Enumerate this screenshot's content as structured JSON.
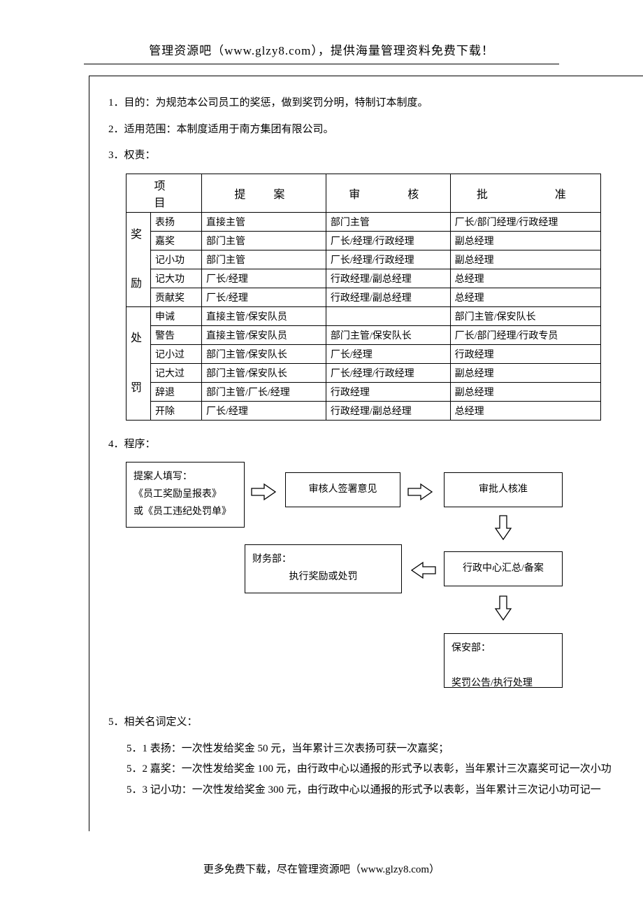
{
  "header": "管理资源吧（www.glzy8.com），提供海量管理资料免费下载！",
  "footer": "更多免费下载，尽在管理资源吧（www.glzy8.com）",
  "paras": {
    "p1": "1．目的：为规范本公司员工的奖惩，做到奖罚分明，特制订本制度。",
    "p2": "2．适用范围：本制度适用于南方集团有限公司。",
    "p3": "3．权责：",
    "p4": "4．程序：",
    "p5": "5．相关名词定义："
  },
  "table": {
    "headers": [
      "项　　目",
      "提　案",
      "审　　核",
      "批　　　准"
    ],
    "groups": [
      {
        "label": "奖励",
        "rows": [
          {
            "sub": "表扬",
            "a": "直接主管",
            "b": "部门主管",
            "c": "厂长/部门经理/行政经理"
          },
          {
            "sub": "嘉奖",
            "a": "部门主管",
            "b": "厂长/经理/行政经理",
            "c": "副总经理"
          },
          {
            "sub": "记小功",
            "a": "部门主管",
            "b": "厂长/经理/行政经理",
            "c": "副总经理"
          },
          {
            "sub": "记大功",
            "a": "厂长/经理",
            "b": "行政经理/副总经理",
            "c": "总经理"
          },
          {
            "sub": "贡献奖",
            "a": "厂长/经理",
            "b": "行政经理/副总经理",
            "c": "总经理"
          }
        ]
      },
      {
        "label": "处罚",
        "rows": [
          {
            "sub": "申诫",
            "a": "直接主管/保安队员",
            "b": "",
            "c": "部门主管/保安队长"
          },
          {
            "sub": "警告",
            "a": "直接主管/保安队员",
            "b": "部门主管/保安队长",
            "c": "厂长/部门经理/行政专员"
          },
          {
            "sub": "记小过",
            "a": "部门主管/保安队长",
            "b": "厂长/经理",
            "c": "行政经理"
          },
          {
            "sub": "记大过",
            "a": "部门主管/保安队长",
            "b": "厂长/经理/行政经理",
            "c": "副总经理"
          },
          {
            "sub": "辞退",
            "a": "部门主管/厂长/经理",
            "b": "行政经理",
            "c": "副总经理"
          },
          {
            "sub": "开除",
            "a": "厂长/经理",
            "b": "行政经理/副总经理",
            "c": "总经理"
          }
        ]
      }
    ]
  },
  "flow": {
    "b1_l1": "提案人填写：",
    "b1_l2": "《员工奖励呈报表》",
    "b1_l3": "或《员工违纪处罚单》",
    "b2": "审核人签署意见",
    "b3": "审批人核准",
    "b4": "行政中心汇总/备案",
    "b5_l1": "财务部：",
    "b5_l2": "执行奖励或处罚",
    "b6_l1": "保安部：",
    "b6_l2": "奖罚公告/执行处理"
  },
  "defs": {
    "d1": "5．1 表扬：一次性发给奖金 50 元，当年累计三次表扬可获一次嘉奖；",
    "d2": "5．2 嘉奖：一次性发给奖金 100 元，由行政中心以通报的形式予以表彰，当年累计三次嘉奖可记一次小功",
    "d3": "5．3 记小功：一次性发给奖金 300 元，由行政中心以通报的形式予以表彰，当年累计三次记小功可记一"
  }
}
